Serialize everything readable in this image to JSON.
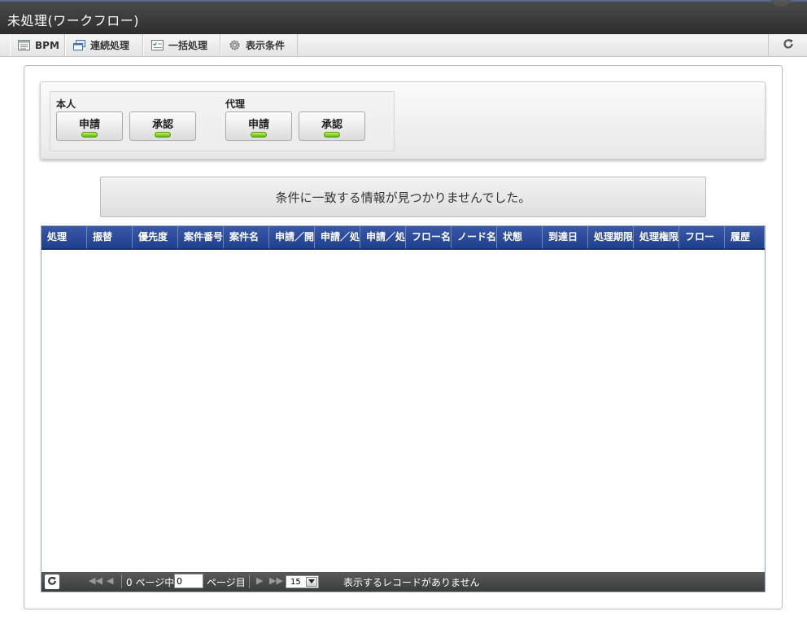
{
  "window": {
    "title": "未処理(ワークフロー)"
  },
  "tabs": [
    {
      "label": "BPM",
      "icon": "list-icon"
    },
    {
      "label": "連続処理",
      "icon": "windows-icon"
    },
    {
      "label": "一括処理",
      "icon": "checklist-icon"
    },
    {
      "label": "表示条件",
      "icon": "gear-icon"
    }
  ],
  "filter": {
    "self": {
      "label": "本人",
      "apply": "申請",
      "approve": "承認"
    },
    "proxy": {
      "label": "代理",
      "apply": "申請",
      "approve": "承認"
    }
  },
  "message": "条件に一致する情報が見つかりませんでした。",
  "grid": {
    "columns": [
      "処理",
      "振替",
      "優先度",
      "案件番号",
      "案件名",
      "申請／開",
      "申請／処",
      "申請／処",
      "フロー名",
      "ノード名",
      "状態",
      "到達日",
      "処理期限",
      "処理権限",
      "フロー",
      "履歴"
    ]
  },
  "pager": {
    "page_prefix": "0 ページ中",
    "page_value": "0",
    "page_suffix": "ページ目",
    "page_size": "15",
    "no_records": "表示するレコードがありません"
  },
  "colors": {
    "header_blue": "#274a9c",
    "led_green": "#7cd420",
    "titlebar": "#3a3a3a"
  }
}
